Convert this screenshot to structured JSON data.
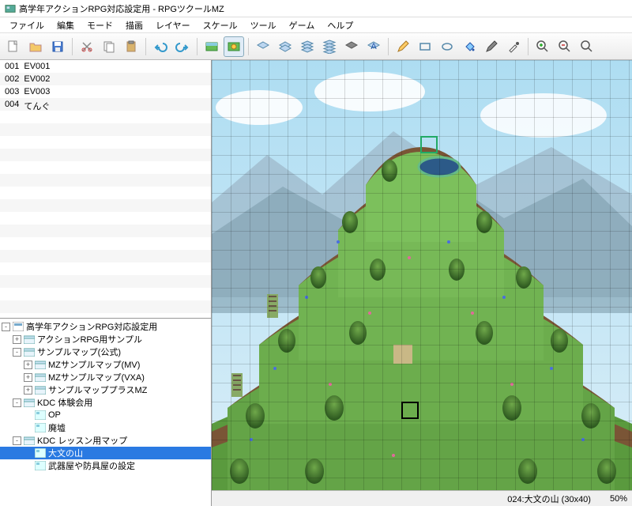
{
  "title": "高学年アクションRPG対応設定用 - RPGツクールMZ",
  "menus": [
    "ファイル",
    "編集",
    "モード",
    "描画",
    "レイヤー",
    "スケール",
    "ツール",
    "ゲーム",
    "ヘルプ"
  ],
  "events": [
    {
      "id": "001",
      "name": "EV001"
    },
    {
      "id": "002",
      "name": "EV002"
    },
    {
      "id": "003",
      "name": "EV003"
    },
    {
      "id": "004",
      "name": "てんぐ"
    }
  ],
  "tree": [
    {
      "depth": 0,
      "tog": "-",
      "icon": "project",
      "label": "高学年アクションRPG対応設定用"
    },
    {
      "depth": 1,
      "tog": "+",
      "icon": "folder",
      "label": "アクションRPG用サンプル"
    },
    {
      "depth": 1,
      "tog": "-",
      "icon": "folder",
      "label": "サンプルマップ(公式)"
    },
    {
      "depth": 2,
      "tog": "+",
      "icon": "folder",
      "label": "MZサンプルマップ(MV)"
    },
    {
      "depth": 2,
      "tog": "+",
      "icon": "folder",
      "label": "MZサンプルマップ(VXA)"
    },
    {
      "depth": 2,
      "tog": "+",
      "icon": "folder",
      "label": "サンプルマッププラスMZ"
    },
    {
      "depth": 1,
      "tog": "-",
      "icon": "folder",
      "label": "KDC 体験会用"
    },
    {
      "depth": 2,
      "tog": "",
      "icon": "map",
      "label": "OP"
    },
    {
      "depth": 2,
      "tog": "",
      "icon": "map",
      "label": "廃墟"
    },
    {
      "depth": 1,
      "tog": "-",
      "icon": "folder",
      "label": "KDC レッスン用マップ"
    },
    {
      "depth": 2,
      "tog": "",
      "icon": "map",
      "label": "大文の山",
      "selected": true
    },
    {
      "depth": 2,
      "tog": "",
      "icon": "map",
      "label": "武器屋や防具屋の設定"
    }
  ],
  "status": {
    "mapinfo": "024:大文の山 (30x40)",
    "zoom": "50%"
  },
  "toolbar_icons": [
    "new-file",
    "open-file",
    "save-file",
    "cut",
    "copy",
    "paste",
    "undo",
    "redo",
    "map-mode",
    "event-mode",
    "layer-1",
    "layer-2",
    "layer-3",
    "layer-4",
    "layer-shadow",
    "layer-auto",
    "pencil",
    "rect",
    "ellipse",
    "fill",
    "shadow-pen",
    "eyedropper",
    "zoom-in",
    "zoom-out",
    "zoom-actual"
  ]
}
